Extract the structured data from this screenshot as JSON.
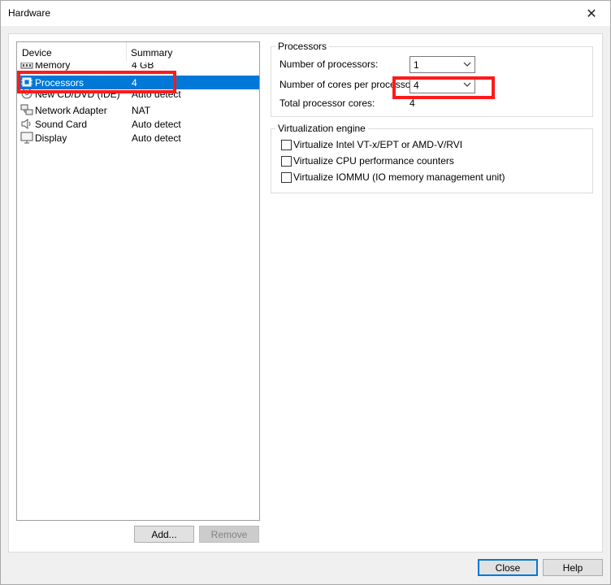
{
  "window": {
    "title": "Hardware",
    "close_glyph": "✕"
  },
  "device_list": {
    "col_device": "Device",
    "col_summary": "Summary",
    "items": [
      {
        "name": "Memory",
        "summary": "4 GB",
        "icon": "memory-icon"
      },
      {
        "name": "Processors",
        "summary": "4",
        "icon": "processor-icon",
        "selected": true
      },
      {
        "name": "New CD/DVD (IDE)",
        "summary": "Auto detect",
        "icon": "cd-dvd-icon"
      },
      {
        "name": "Network Adapter",
        "summary": "NAT",
        "icon": "network-adapter-icon"
      },
      {
        "name": "Sound Card",
        "summary": "Auto detect",
        "icon": "sound-card-icon"
      },
      {
        "name": "Display",
        "summary": "Auto detect",
        "icon": "display-icon"
      }
    ],
    "add_label": "Add...",
    "remove_label": "Remove"
  },
  "processors": {
    "group_label": "Processors",
    "num_processors_label": "Number of processors:",
    "num_processors_value": "1",
    "cores_label": "Number of cores per processor:",
    "cores_value": "4",
    "total_label": "Total processor cores:",
    "total_value": "4"
  },
  "virtualization": {
    "group_label": "Virtualization engine",
    "options": [
      {
        "label": "Virtualize Intel VT-x/EPT or AMD-V/RVI",
        "checked": false
      },
      {
        "label": "Virtualize CPU performance counters",
        "checked": false
      },
      {
        "label": "Virtualize IOMMU (IO memory management unit)",
        "checked": false
      }
    ]
  },
  "footer": {
    "close_label": "Close",
    "help_label": "Help"
  },
  "colors": {
    "selection": "#0078d7",
    "highlight": "#ff1a1a",
    "default_button_border": "#0078d7"
  }
}
